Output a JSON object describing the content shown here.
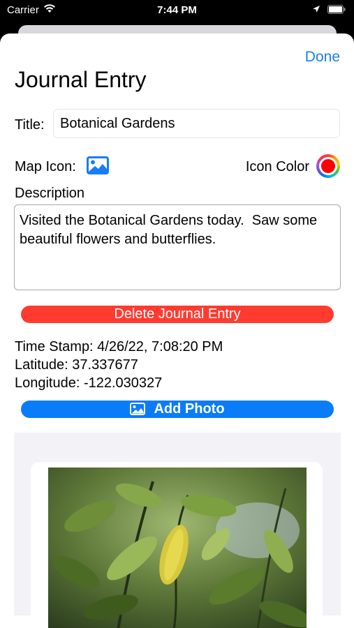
{
  "status_bar": {
    "carrier": "Carrier",
    "time": "7:44 PM"
  },
  "nav": {
    "done_label": "Done"
  },
  "page_title": "Journal Entry",
  "form": {
    "title_label": "Title:",
    "title_value": "Botanical Gardens",
    "map_icon_label": "Map Icon:",
    "map_icon": "photo-icon",
    "icon_color_label": "Icon Color",
    "icon_color": "#ff0000",
    "description_label": "Description",
    "description_value": "Visited the Botanical Gardens today.  Saw some beautiful flowers and butterflies."
  },
  "delete_label": "Delete Journal Entry",
  "info": {
    "timestamp": "Time Stamp: 4/26/22, 7:08:20 PM",
    "latitude": "Latitude: 37.337677",
    "longitude": "Longitude: -122.030327"
  },
  "add_photo_label": "Add Photo",
  "colors": {
    "accent": "#0a7cf8",
    "destructive": "#ff3b30"
  }
}
